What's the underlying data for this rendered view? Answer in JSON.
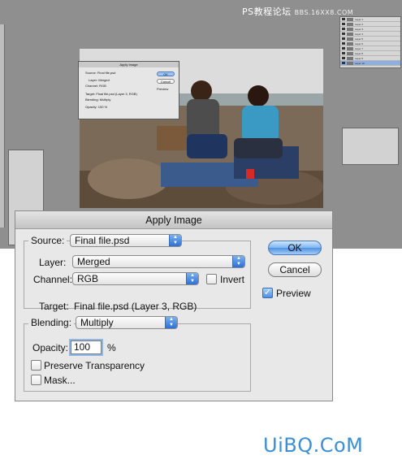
{
  "watermark_top": {
    "text": "PS教程论坛",
    "url": "BBS.16XX8.COM"
  },
  "background_layers": [
    "Layer 1",
    "Layer 2",
    "Layer 3",
    "Layer 4",
    "Layer 5",
    "Layer 6",
    "Layer 7",
    "Layer 8",
    "Layer 9",
    "Layer 10"
  ],
  "small_dialog": {
    "title": "Apply Image",
    "source": "Final file.psd",
    "layer": "Merged",
    "channel": "RGB",
    "target": "Final file.psd (Layer 3, RGB)",
    "blending": "Multiply",
    "opacity": "100",
    "ok": "OK",
    "cancel": "Cancel",
    "preview": "Preview"
  },
  "dialog": {
    "title": "Apply Image",
    "source_label": "Source:",
    "source_value": "Final file.psd",
    "layer_label": "Layer:",
    "layer_value": "Merged",
    "channel_label": "Channel:",
    "channel_value": "RGB",
    "invert_label": "Invert",
    "target_label": "Target:",
    "target_value": "Final file.psd (Layer 3, RGB)",
    "blending_label": "Blending:",
    "blending_value": "Multiply",
    "opacity_label": "Opacity:",
    "opacity_value": "100",
    "opacity_unit": "%",
    "preserve_label": "Preserve Transparency",
    "mask_label": "Mask...",
    "ok_label": "OK",
    "cancel_label": "Cancel",
    "preview_label": "Preview"
  },
  "watermark_bottom": "UiBQ.CoM",
  "colors": {
    "accent": "#4f92e0",
    "watermark": "#3b8fd6"
  }
}
